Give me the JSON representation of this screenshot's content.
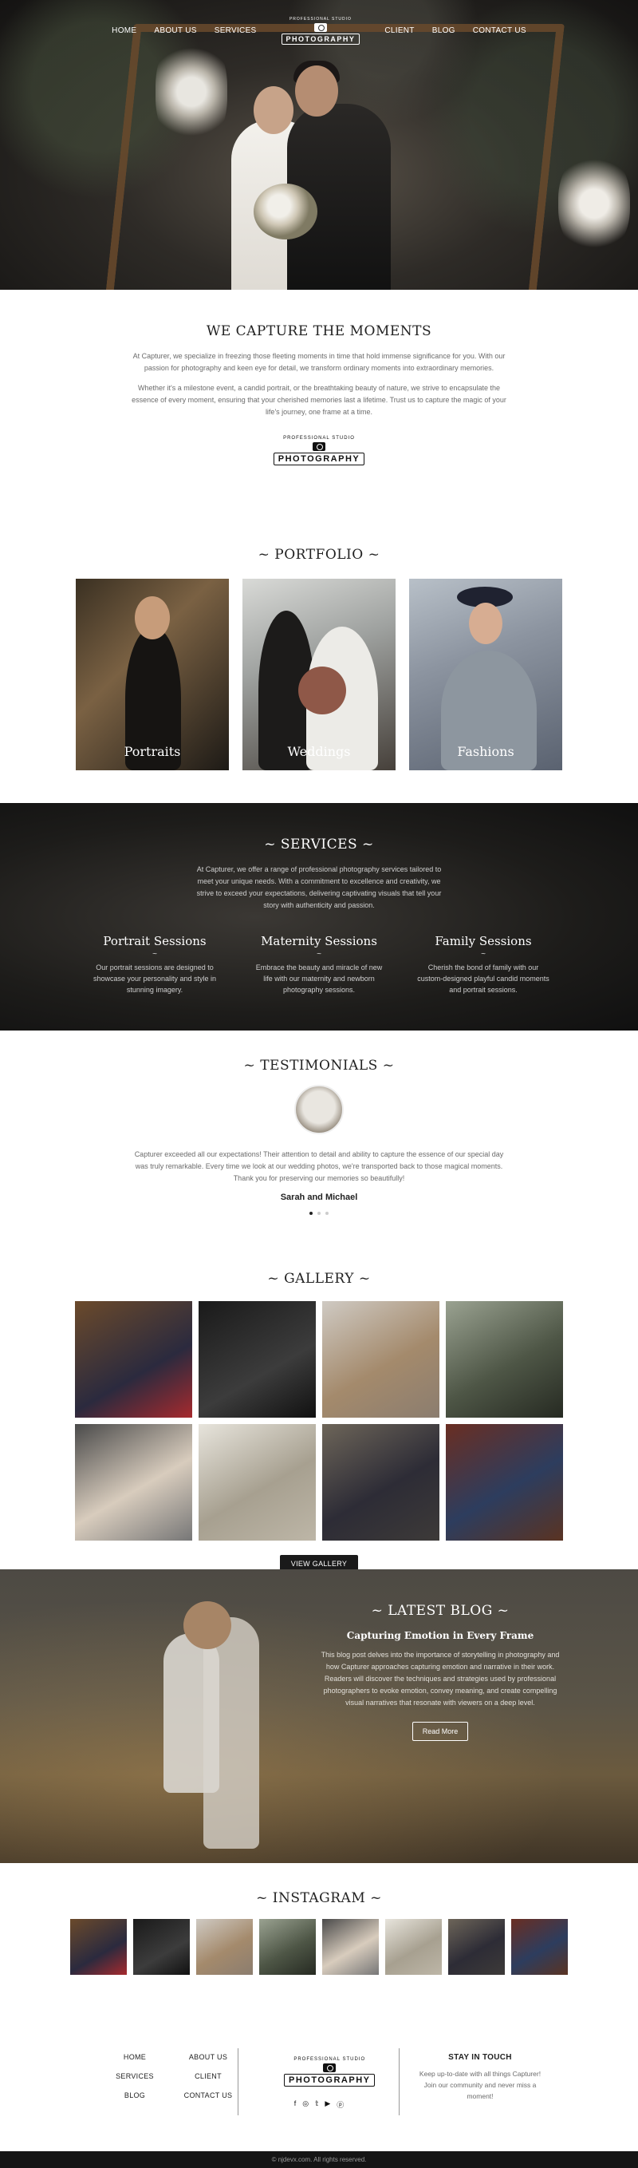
{
  "nav": {
    "left": [
      "HOME",
      "ABOUT US",
      "SERVICES"
    ],
    "right": [
      "CLIENT",
      "BLOG",
      "CONTACT US"
    ],
    "logo": {
      "arc": "PROFESSIONAL STUDIO",
      "word": "PHOTOGRAPHY"
    }
  },
  "about": {
    "title": "WE CAPTURE THE MOMENTS",
    "p1": "At Capturer, we specialize in freezing those fleeting moments in time that hold immense significance for you. With our passion for photography and keen eye for detail, we transform ordinary moments into extraordinary memories.",
    "p2": "Whether it's a milestone event, a candid portrait, or the breathtaking beauty of nature, we strive to encapsulate the essence of every moment, ensuring that your cherished memories last a lifetime. Trust us to capture the magic of your life's journey, one frame at a time."
  },
  "portfolio": {
    "title": "~ PORTFOLIO ~",
    "items": [
      "Portraits",
      "Weddings",
      "Fashions"
    ]
  },
  "services": {
    "title": "~ SERVICES ~",
    "intro": "At Capturer, we offer a range of professional photography services tailored to meet your unique needs. With a commitment to excellence and creativity, we strive to exceed your expectations, delivering captivating visuals that tell your story with authenticity and passion.",
    "items": [
      {
        "name": "Portrait Sessions",
        "desc": "Our portrait sessions are designed to showcase your personality and style in stunning imagery."
      },
      {
        "name": "Maternity Sessions",
        "desc": "Embrace the beauty and miracle of new life with our maternity and newborn photography sessions."
      },
      {
        "name": "Family Sessions",
        "desc": "Cherish the bond of family with our custom-designed playful candid moments and portrait sessions."
      }
    ]
  },
  "testimonials": {
    "title": "~ TESTIMONIALS ~",
    "quote": "Capturer exceeded all our expectations! Their attention to detail and ability to capture the essence of our special day was truly remarkable. Every time we look at our wedding photos, we're transported back to those magical moments. Thank you for preserving our memories so beautifully!",
    "author": "Sarah and Michael"
  },
  "gallery": {
    "title": "~ GALLERY ~",
    "button": "VIEW GALLERY"
  },
  "blog": {
    "title": "~ LATEST BLOG ~",
    "post_title": "Capturing Emotion in Every Frame",
    "excerpt": "This blog post delves into the importance of storytelling in photography and how Capturer approaches capturing emotion and narrative in their work. Readers will discover the techniques and strategies used by professional photographers to evoke emotion, convey meaning, and create compelling visual narratives that resonate with viewers on a deep level.",
    "button": "Read More"
  },
  "instagram": {
    "title": "~ INSTAGRAM ~"
  },
  "footer": {
    "links": [
      "HOME",
      "ABOUT US",
      "SERVICES",
      "CLIENT",
      "BLOG",
      "CONTACT US"
    ],
    "social_icons": [
      "facebook-icon",
      "instagram-icon",
      "twitter-icon",
      "youtube-icon",
      "pinterest-icon"
    ],
    "social_glyphs": [
      "f",
      "◎",
      "𝕥",
      "▶",
      "ⓟ"
    ],
    "stay_title": "STAY IN TOUCH",
    "stay_text": "Keep up-to-date with all things Capturer! Join our community and never miss a moment!",
    "copyright": "© njdevx.com. All rights reserved."
  }
}
